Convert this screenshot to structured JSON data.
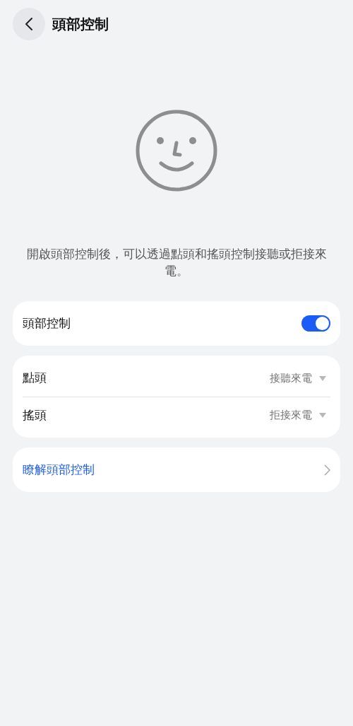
{
  "header": {
    "title": "頭部控制"
  },
  "description": "開啟頭部控制後，可以透過點頭和搖頭控制接聽或拒接來電。",
  "toggle_card": {
    "label": "頭部控制",
    "on": true
  },
  "gesture_rows": [
    {
      "label": "點頭",
      "value": "接聽來電"
    },
    {
      "label": "搖頭",
      "value": "拒接來電"
    }
  ],
  "link": {
    "label": "瞭解頭部控制"
  }
}
